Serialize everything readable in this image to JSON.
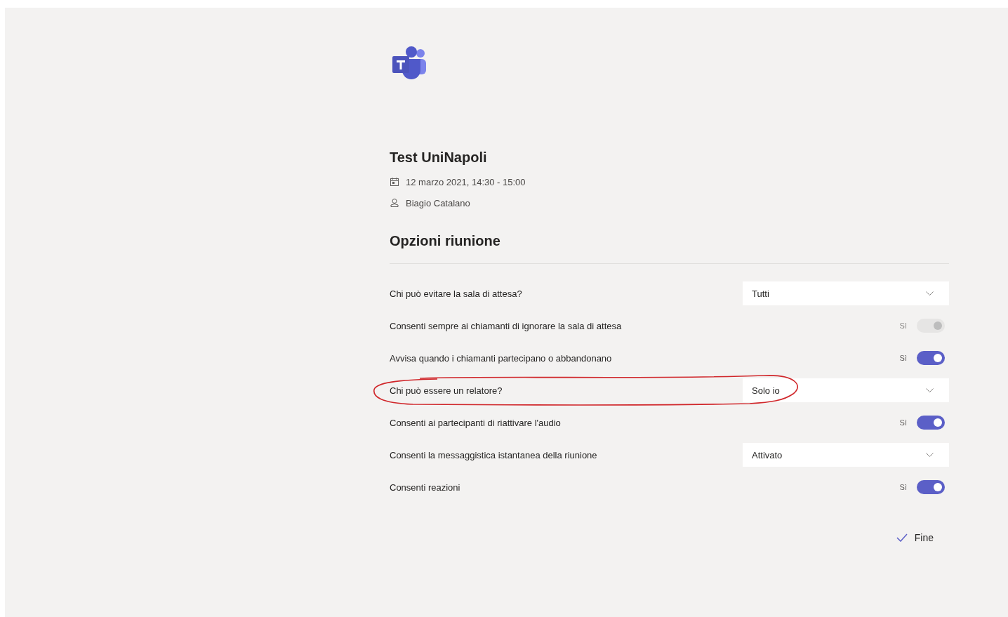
{
  "meeting": {
    "title": "Test UniNapoli",
    "date": "12 marzo 2021, 14:30 - 15:00",
    "organizer": "Biagio Catalano"
  },
  "section_title": "Opzioni riunione",
  "options": [
    {
      "kind": "dropdown",
      "label": "Chi può evitare la sala di attesa?",
      "value": "Tutti",
      "highlighted": false
    },
    {
      "kind": "toggle",
      "label": "Consenti sempre ai chiamanti di ignorare la sala di attesa",
      "state_label": "Sì",
      "on": true,
      "disabled": true,
      "highlighted": false
    },
    {
      "kind": "toggle",
      "label": "Avvisa quando i chiamanti partecipano o abbandonano",
      "state_label": "Sì",
      "on": true,
      "disabled": false,
      "highlighted": false
    },
    {
      "kind": "dropdown",
      "label": "Chi può essere un relatore?",
      "value": "Solo io",
      "highlighted": true
    },
    {
      "kind": "toggle",
      "label": "Consenti ai partecipanti di riattivare l'audio",
      "state_label": "Sì",
      "on": true,
      "disabled": false,
      "highlighted": false
    },
    {
      "kind": "dropdown",
      "label": "Consenti la messaggistica istantanea della riunione",
      "value": "Attivato",
      "highlighted": false
    },
    {
      "kind": "toggle",
      "label": "Consenti reazioni",
      "state_label": "Sì",
      "on": true,
      "disabled": false,
      "highlighted": false
    }
  ],
  "done_button": {
    "label": "Fine"
  }
}
